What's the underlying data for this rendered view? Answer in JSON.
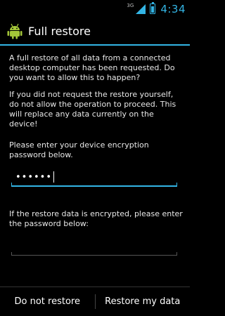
{
  "status_bar": {
    "network_label": "3G",
    "battery_level": 0.7,
    "time": "4:34"
  },
  "dialog": {
    "title": "Full restore",
    "app_icon": "android-robot-icon",
    "message_1": "A full restore of all data from a connected desktop computer has been requested. Do you want to allow this to happen?",
    "message_2": "If you did not request the restore yourself, do not allow the operation to proceed. This will replace any data currently on the device!",
    "password_prompt": "Please enter your device encryption password below.",
    "password_value": "••••••",
    "encrypted_prompt": "If the restore data is encrypted, please enter the password below:",
    "encrypted_value": ""
  },
  "buttons": {
    "deny_label": "Do not restore",
    "allow_label": "Restore my data"
  },
  "colors": {
    "accent": "#33b5e5",
    "android_green": "#a4c639"
  }
}
